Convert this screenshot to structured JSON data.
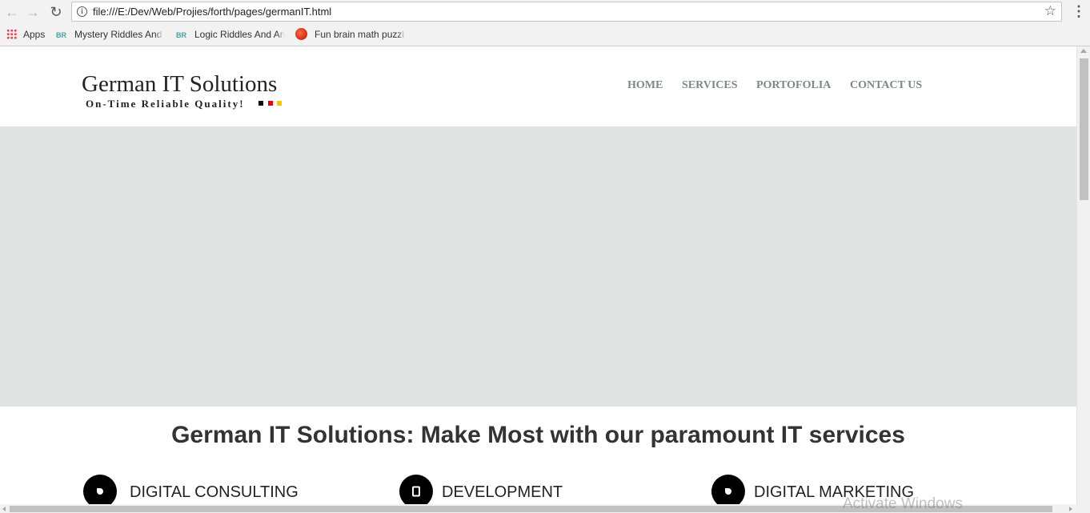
{
  "browser": {
    "back_icon": "arrow-left-icon",
    "forward_icon": "arrow-right-icon",
    "reload_icon": "reload-icon",
    "url": "file:///E:/Dev/Web/Projies/forth/pages/germanIT.html",
    "info_icon": "info-icon",
    "star_icon": "star-icon",
    "menu_icon": "kebab-menu-icon",
    "bookmarks": [
      {
        "label": "Apps",
        "icon": "apps-grid-icon"
      },
      {
        "label": "Mystery Riddles And",
        "badge": "BR"
      },
      {
        "label": "Logic Riddles And An",
        "badge": "BR"
      },
      {
        "label": "Fun brain math puzzl",
        "icon": "red-ball-icon"
      }
    ]
  },
  "site": {
    "logo_title": "German IT Solutions",
    "logo_tagline": "On-Time Reliable Quality!",
    "flag_colors": [
      "#111111",
      "#ee0000",
      "#f6c400"
    ],
    "nav": [
      "HOME",
      "SERVICES",
      "PORTOFOLIA",
      "CONTACT US"
    ],
    "hero_color": "#dfe4e2",
    "headline": "German IT Solutions: Make Most with our paramount IT services",
    "services": [
      {
        "label": "DIGITAL CONSULTING",
        "icon": "drop-icon"
      },
      {
        "label": "DEVELOPMENT",
        "icon": "tablet-icon"
      },
      {
        "label": "DIGITAL MARKETING",
        "icon": "drop-icon"
      }
    ]
  },
  "os": {
    "watermark": "Activate Windows"
  }
}
